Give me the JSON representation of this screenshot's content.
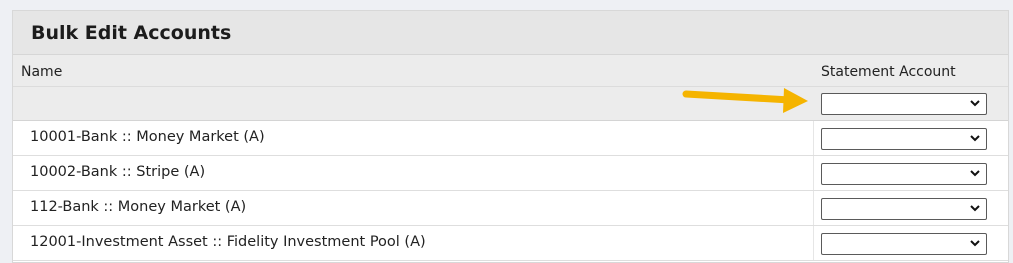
{
  "panel": {
    "title": "Bulk Edit Accounts"
  },
  "table": {
    "columns": {
      "name": "Name",
      "statement_account": "Statement Account"
    },
    "filter": {
      "statement_account_value": ""
    },
    "rows": [
      {
        "name": "10001-Bank :: Money Market (A)",
        "statement_account": ""
      },
      {
        "name": "10002-Bank :: Stripe (A)",
        "statement_account": ""
      },
      {
        "name": "112-Bank :: Money Market (A)",
        "statement_account": ""
      },
      {
        "name": "12001-Investment Asset :: Fidelity Investment Pool (A)",
        "statement_account": ""
      }
    ]
  },
  "icons": {
    "dropdown": "chevron-down-icon",
    "annotation": "arrow-annotation"
  },
  "colors": {
    "annotation_arrow": "#f5b400",
    "header_bg": "#e6e6e6"
  }
}
